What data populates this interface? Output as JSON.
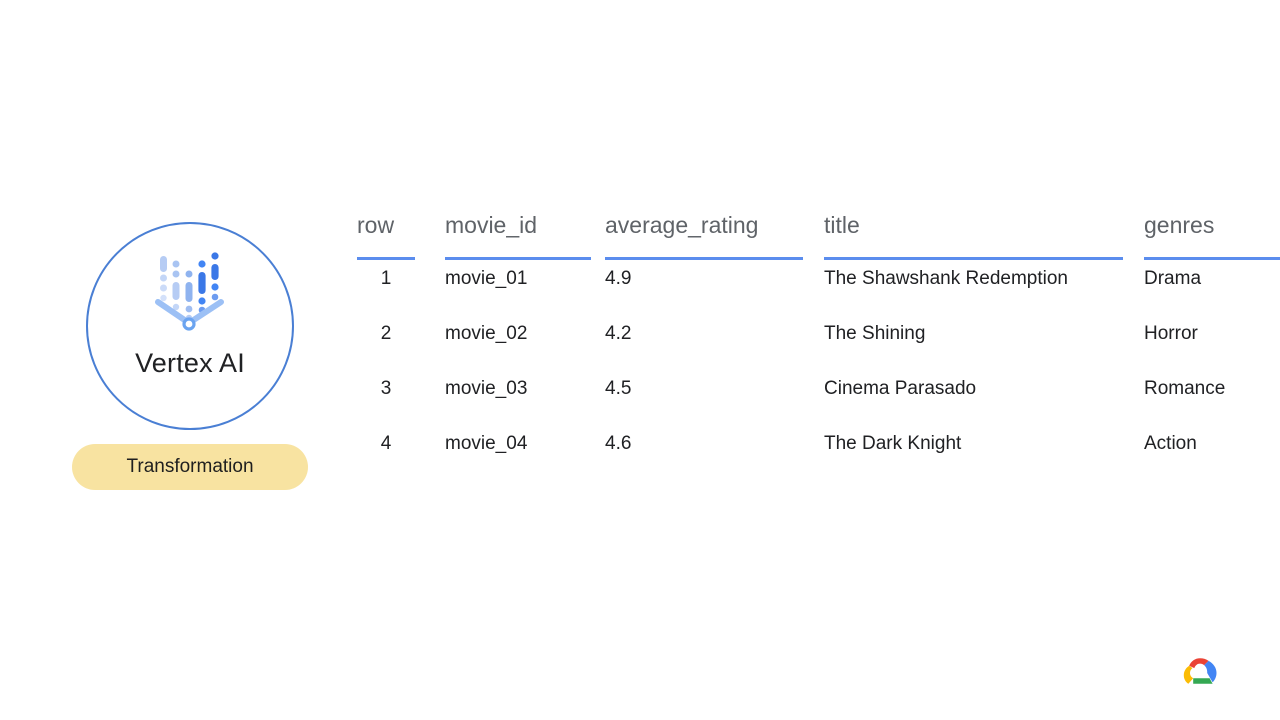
{
  "node": {
    "label": "Vertex AI",
    "icon": "vertex-ai-icon",
    "badge": "Transformation",
    "badge_color": "#f8e3a1",
    "circle_color": "#4a7fd4"
  },
  "brand": {
    "logo": "google-cloud-icon"
  },
  "table": {
    "accent_color": "#5b8dee",
    "header_color": "#5f6368",
    "cell_color": "#202124",
    "columns": [
      {
        "key": "row",
        "label": "row"
      },
      {
        "key": "movie_id",
        "label": "movie_id"
      },
      {
        "key": "average_rating",
        "label": "average_rating"
      },
      {
        "key": "title",
        "label": "title"
      },
      {
        "key": "genres",
        "label": "genres"
      }
    ],
    "rows": [
      {
        "row": "1",
        "movie_id": "movie_01",
        "average_rating": "4.9",
        "title": "The Shawshank Redemption",
        "genres": "Drama"
      },
      {
        "row": "2",
        "movie_id": "movie_02",
        "average_rating": "4.2",
        "title": "The Shining",
        "genres": "Horror"
      },
      {
        "row": "3",
        "movie_id": "movie_03",
        "average_rating": "4.5",
        "title": "Cinema Parasado",
        "genres": "Romance"
      },
      {
        "row": "4",
        "movie_id": "movie_04",
        "average_rating": "4.6",
        "title": "The Dark Knight",
        "genres": "Action"
      }
    ]
  }
}
